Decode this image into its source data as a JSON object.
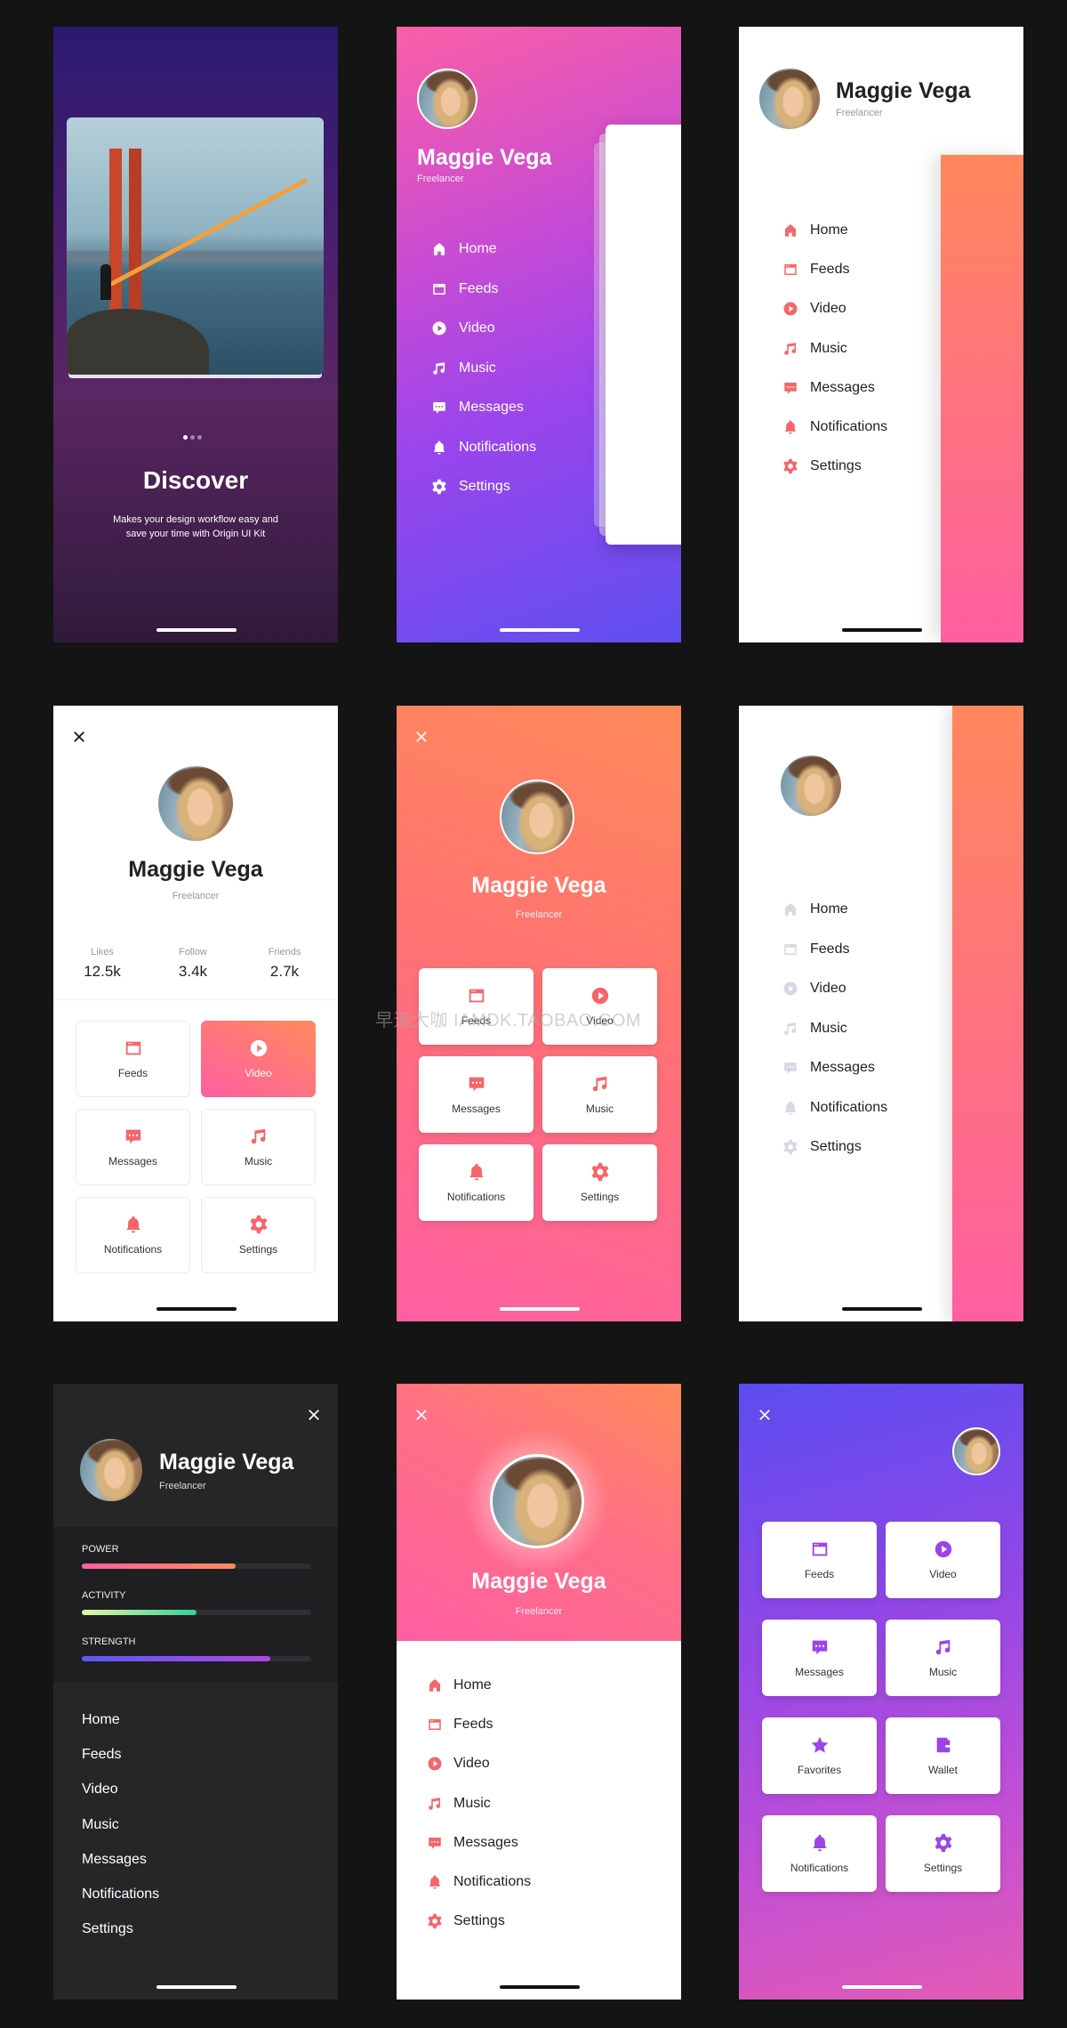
{
  "user": {
    "name": "Maggie Vega",
    "role": "Freelancer"
  },
  "onboarding": {
    "title": "Discover",
    "subtitle_line1": "Makes your design workflow easy and",
    "subtitle_line2": "save your time with Origin UI Kit",
    "page_count": 3,
    "active_page": 1
  },
  "menu": [
    {
      "label": "Home",
      "icon": "home-icon"
    },
    {
      "label": "Feeds",
      "icon": "feeds-icon"
    },
    {
      "label": "Video",
      "icon": "video-icon"
    },
    {
      "label": "Music",
      "icon": "music-icon"
    },
    {
      "label": "Messages",
      "icon": "messages-icon"
    },
    {
      "label": "Notifications",
      "icon": "bell-icon"
    },
    {
      "label": "Settings",
      "icon": "gear-icon"
    }
  ],
  "stats": [
    {
      "label": "Likes",
      "value": "12.5k"
    },
    {
      "label": "Follow",
      "value": "3.4k"
    },
    {
      "label": "Friends",
      "value": "2.7k"
    }
  ],
  "grid6": [
    {
      "label": "Feeds",
      "icon": "feeds-icon"
    },
    {
      "label": "Video",
      "icon": "video-icon"
    },
    {
      "label": "Messages",
      "icon": "messages-icon"
    },
    {
      "label": "Music",
      "icon": "music-icon"
    },
    {
      "label": "Notifications",
      "icon": "bell-icon"
    },
    {
      "label": "Settings",
      "icon": "gear-icon"
    }
  ],
  "grid8": [
    {
      "label": "Feeds",
      "icon": "feeds-icon"
    },
    {
      "label": "Video",
      "icon": "video-icon"
    },
    {
      "label": "Messages",
      "icon": "messages-icon"
    },
    {
      "label": "Music",
      "icon": "music-icon"
    },
    {
      "label": "Favorites",
      "icon": "star-icon"
    },
    {
      "label": "Wallet",
      "icon": "wallet-icon"
    },
    {
      "label": "Notifications",
      "icon": "bell-icon"
    },
    {
      "label": "Settings",
      "icon": "gear-icon"
    }
  ],
  "dark_stats": [
    {
      "label": "POWER",
      "percent": 67,
      "colors": [
        "#ff5f9e",
        "#ff8a5c"
      ]
    },
    {
      "label": "ACTIVITY",
      "percent": 50,
      "colors": [
        "#e6f7a0",
        "#2fd39a"
      ]
    },
    {
      "label": "STRENGTH",
      "percent": 82,
      "colors": [
        "#5b57f0",
        "#b04ae6"
      ]
    }
  ],
  "active_tile": "Video",
  "colors": {
    "accent": "#f7656a",
    "purple_accent": "#9b45e8",
    "inactive_icon": "#d8d8e2",
    "dark_bg": "#262628"
  },
  "watermark": "早道大咖  IAMDK.TAOBAO.COM"
}
